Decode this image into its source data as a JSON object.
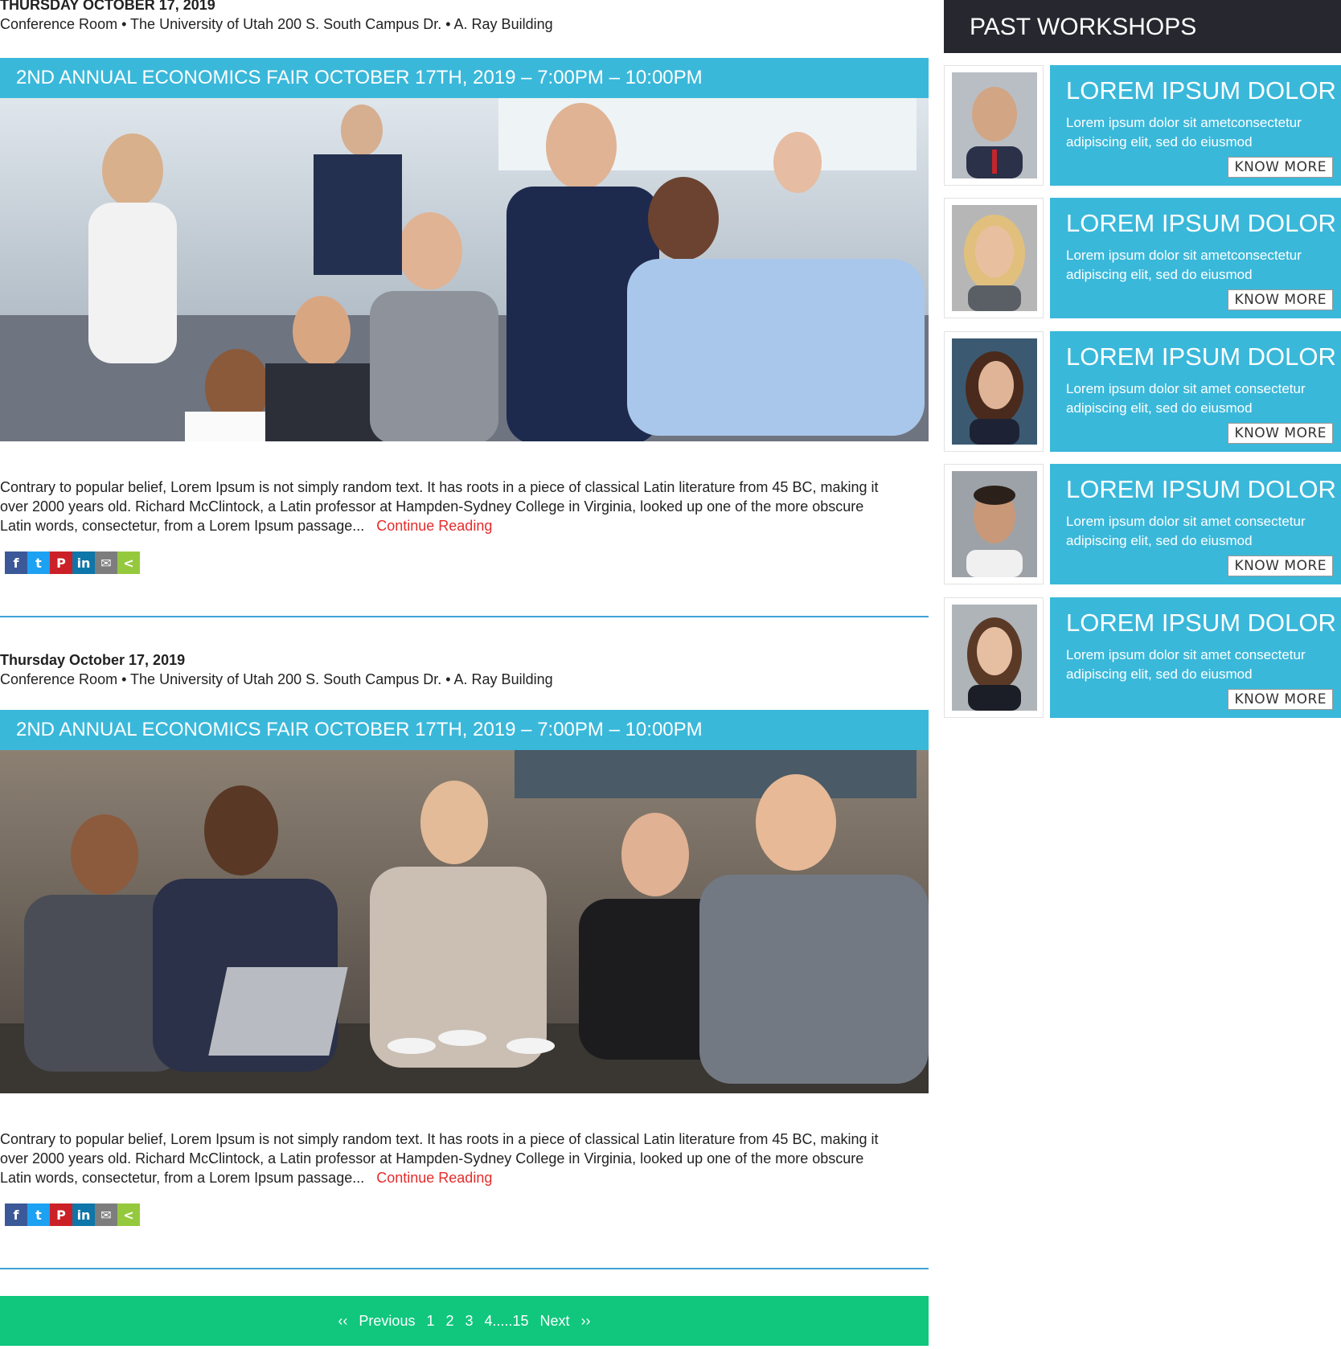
{
  "events": [
    {
      "date": "THURSDAY OCTOBER 17, 2019",
      "location": "Conference Room • The University of Utah 200 S. South Campus Dr. • A. Ray Building",
      "title": "2ND ANNUAL ECONOMICS FAIR OCTOBER 17TH, 2019 – 7:00PM – 10:00PM",
      "excerpt": "Contrary to popular belief, Lorem Ipsum is not simply random text. It has roots in a piece of classical Latin literature from 45 BC, making it over 2000 years old. Richard McClintock, a Latin professor at Hampden-Sydney College in Virginia, looked up one of the more obscure Latin words, consectetur, from a Lorem Ipsum passage...",
      "continue_label": "Continue Reading"
    },
    {
      "date": "Thursday October 17, 2019",
      "location": "Conference Room • The University of Utah 200 S. South Campus Dr. • A. Ray Building",
      "title": "2ND ANNUAL ECONOMICS FAIR OCTOBER 17TH, 2019 – 7:00PM – 10:00PM",
      "excerpt": "Contrary to popular belief, Lorem Ipsum is not simply random text. It has roots in a piece of classical Latin literature from 45 BC, making it over 2000 years old. Richard McClintock, a Latin professor at Hampden-Sydney College in Virginia, looked up one of the more obscure Latin words, consectetur, from a Lorem Ipsum passage...",
      "continue_label": "Continue Reading"
    }
  ],
  "share_icons": [
    {
      "icon": "facebook-icon",
      "glyph": "f",
      "color": "#3b5998"
    },
    {
      "icon": "twitter-icon",
      "glyph": "t",
      "color": "#1da1f2"
    },
    {
      "icon": "pinterest-icon",
      "glyph": "P",
      "color": "#cb2027"
    },
    {
      "icon": "linkedin-icon",
      "glyph": "in",
      "color": "#0e76a8"
    },
    {
      "icon": "email-icon",
      "glyph": "✉",
      "color": "#7d7d7d"
    },
    {
      "icon": "share-icon",
      "glyph": "<",
      "color": "#95c93d"
    }
  ],
  "pagination": {
    "prev_arrow": "‹‹",
    "previous": "Previous",
    "pages": [
      "1",
      "2",
      "3",
      "4.....15"
    ],
    "next": "Next",
    "next_arrow": "››"
  },
  "sidebar": {
    "heading": "PAST WORKSHOPS",
    "cards": [
      {
        "title": "LOREM IPSUM DOLOR",
        "text": "Lorem ipsum dolor sit ametconsectetur adipiscing elit, sed do eiusmod",
        "button": "KNOW MORE"
      },
      {
        "title": "LOREM IPSUM DOLOR",
        "text": "Lorem ipsum dolor sit ametconsectetur adipiscing elit, sed do eiusmod",
        "button": "KNOW MORE"
      },
      {
        "title": "LOREM IPSUM DOLOR",
        "text": "Lorem ipsum dolor sit amet consectetur adipiscing elit, sed do eiusmod",
        "button": "KNOW MORE"
      },
      {
        "title": "LOREM IPSUM DOLOR",
        "text": "Lorem ipsum dolor sit amet consectetur adipiscing elit, sed do eiusmod",
        "button": "KNOW MORE"
      },
      {
        "title": "LOREM IPSUM DOLOR",
        "text": "Lorem ipsum dolor sit amet consectetur adipiscing elit, sed do eiusmod",
        "button": "KNOW MORE"
      }
    ]
  },
  "colors": {
    "banner": "#3ab8da",
    "pager": "#10c77d",
    "sidebar_head": "#272730",
    "link": "#e52b2b"
  }
}
